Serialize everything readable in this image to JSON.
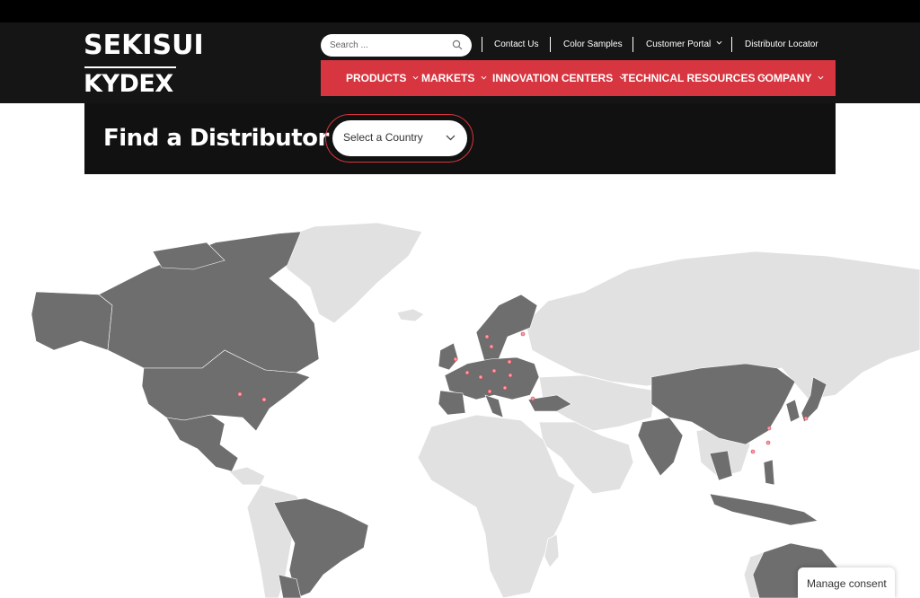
{
  "brand": {
    "logo_line1": "SEKISUI",
    "logo_line2": "KYDEX"
  },
  "search": {
    "placeholder": "Search ...",
    "value": "",
    "icon": "search-icon"
  },
  "utility_nav": [
    {
      "label": "Contact Us"
    },
    {
      "label": "Color Samples"
    },
    {
      "label": "Customer Portal",
      "has_dropdown": true
    },
    {
      "label": "Distributor Locator"
    }
  ],
  "main_nav": [
    {
      "label": "PRODUCTS",
      "has_dropdown": true
    },
    {
      "label": "MARKETS",
      "has_dropdown": true
    },
    {
      "label": "INNOVATION CENTERS",
      "has_dropdown": true
    },
    {
      "label": "TECHNICAL RESOURCES",
      "has_dropdown": true
    },
    {
      "label": "COMPANY",
      "has_dropdown": true
    }
  ],
  "find": {
    "title": "Find a Distributor",
    "select_value": "Select a Country"
  },
  "map": {
    "highlight_color": "#6e6e6e",
    "base_color": "#e1e1e1",
    "marker_color": "#f08a96",
    "highlighted_regions": [
      "North America",
      "Mexico",
      "Brazil",
      "Argentina",
      "Europe",
      "Turkey",
      "India",
      "China",
      "Japan",
      "Southeast Asia",
      "Australia"
    ]
  },
  "colors": {
    "accent": "#d7353f",
    "header_bg": "#151515",
    "topbar_bg": "#000000"
  },
  "consent": {
    "label": "Manage consent"
  }
}
